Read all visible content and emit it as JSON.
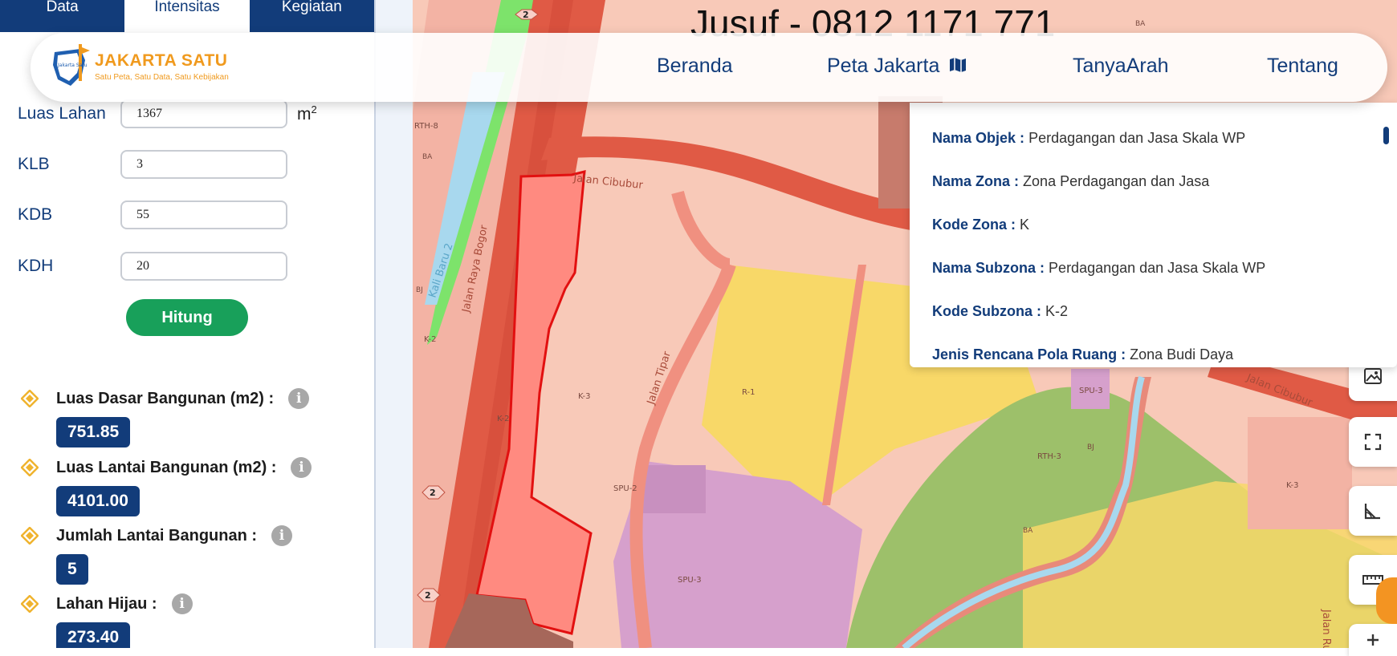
{
  "sidebar": {
    "tabs": [
      {
        "label": "Data",
        "active": false
      },
      {
        "label": "Intensitas",
        "active": true
      },
      {
        "label": "Kegiatan",
        "active": false
      }
    ],
    "fields": {
      "luas_lahan": {
        "label": "Luas Lahan",
        "value": "1367",
        "unit": "m",
        "unit_sup": "2"
      },
      "klb": {
        "label": "KLB",
        "value": "3"
      },
      "kdb": {
        "label": "KDB",
        "value": "55"
      },
      "kdh": {
        "label": "KDH",
        "value": "20"
      }
    },
    "calculate_label": "Hitung",
    "results": [
      {
        "label": "Luas Dasar Bangunan (m2) :",
        "value": "751.85"
      },
      {
        "label": "Luas Lantai Bangunan (m2) :",
        "value": "4101.00"
      },
      {
        "label": "Jumlah Lantai Bangunan :",
        "value": "5"
      },
      {
        "label": "Lahan Hijau :",
        "value": "273.40"
      }
    ],
    "info_glyph": "i"
  },
  "header": {
    "logo_title": "JAKARTA SATU",
    "logo_subtitle": "Satu Peta, Satu Data, Satu Kebijakan",
    "logo_mark_text": "Jakarta Satu",
    "nav": [
      {
        "label": "Beranda"
      },
      {
        "label": "Peta Jakarta",
        "icon": "map-icon"
      },
      {
        "label": "TanyaArah"
      },
      {
        "label": "Tentang"
      }
    ]
  },
  "overlay": {
    "watermark": "Jusuf - 0812 1171 771"
  },
  "popup": {
    "rows": [
      {
        "key": "Nama Objek :",
        "value": "Perdagangan dan Jasa Skala WP"
      },
      {
        "key": "Nama Zona :",
        "value": "Zona Perdagangan dan Jasa"
      },
      {
        "key": "Kode Zona :",
        "value": "K"
      },
      {
        "key": "Nama Subzona :",
        "value": "Perdagangan dan Jasa Skala WP"
      },
      {
        "key": "Kode Subzona :",
        "value": "K-2"
      },
      {
        "key": "Jenis Rencana Pola Ruang :",
        "value": "Zona Budi Daya"
      }
    ]
  },
  "map": {
    "roads": {
      "jalan_raya_bogor": "Jalan Raya Bogor",
      "jalan_cibubur": "Jalan Cibubur",
      "jalan_tipar": "Jalan Tipar",
      "kali_baru": "Kali Baru 2",
      "jalan_rukun": "Jalan Rukun"
    },
    "zones": {
      "k2": "K-2",
      "k3": "K-3",
      "spu2": "SPU-2",
      "spu3": "SPU-3",
      "r1": "R-1",
      "rth3": "RTH-3",
      "rth8": "RTH-8",
      "ba": "BA",
      "bj": "BJ"
    },
    "shields": {
      "route": "2"
    },
    "colors": {
      "primary": "#123c7a",
      "accent": "#f09a1e",
      "green_button": "#18a05a",
      "parcel": "#ff8a80",
      "road": "#e05a45",
      "commercial": "#f8c9b8",
      "residential": "#f8d868",
      "public": "#d6a0cc",
      "green_zone": "#9dc06a",
      "river": "#a8d8ee"
    },
    "control_icons": [
      "image-layers-icon",
      "fullscreen-icon",
      "measure-angle-icon",
      "ruler-icon",
      "zoom-in-icon"
    ]
  }
}
